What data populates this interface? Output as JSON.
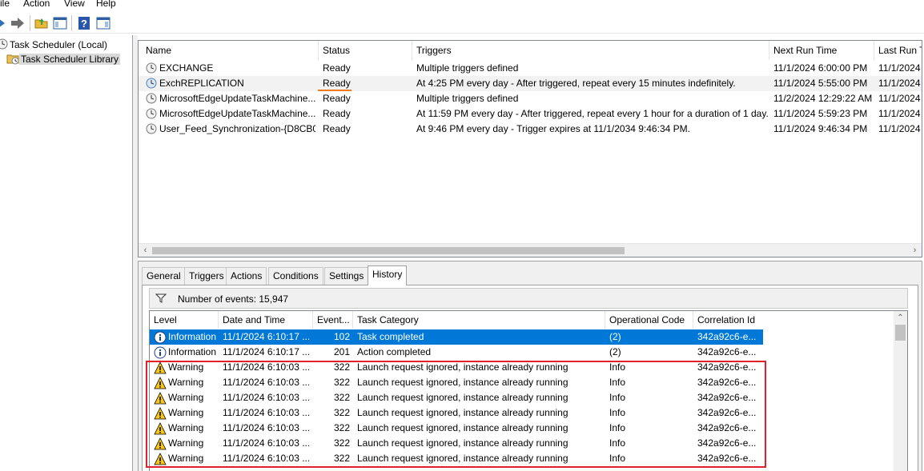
{
  "menu": [
    "ile",
    "Action",
    "View",
    "Help"
  ],
  "toolbar": {
    "buttons": [
      "back-arrow-icon",
      "forward-arrow-icon",
      "up-folder-icon",
      "show-hide-console-tree-icon",
      "help-icon",
      "show-hide-action-pane-icon"
    ]
  },
  "tree": {
    "root": "Task Scheduler (Local)",
    "library": "Task Scheduler Library"
  },
  "tasks": {
    "columns": [
      "Name",
      "Status",
      "Triggers",
      "Next Run Time",
      "Last Run T"
    ],
    "rows": [
      {
        "name": "EXCHANGE",
        "status": "Ready",
        "triggers": "Multiple triggers defined",
        "next": "11/1/2024 6:00:00 PM",
        "last": "11/1/2024"
      },
      {
        "name": "ExchREPLICATION",
        "status": "Ready",
        "triggers": "At 4:25 PM every day - After triggered, repeat every 15 minutes indefinitely.",
        "next": "11/1/2024 5:55:00 PM",
        "last": "11/1/2024"
      },
      {
        "name": "MicrosoftEdgeUpdateTaskMachine...",
        "status": "Ready",
        "triggers": "Multiple triggers defined",
        "next": "11/2/2024 12:29:22 AM",
        "last": "11/1/2024"
      },
      {
        "name": "MicrosoftEdgeUpdateTaskMachine...",
        "status": "Ready",
        "triggers": "At 11:59 PM every day - After triggered, repeat every 1 hour for a duration of 1 day.",
        "next": "11/1/2024 5:59:23 PM",
        "last": "11/1/2024"
      },
      {
        "name": "User_Feed_Synchronization-{D8CB0...",
        "status": "Ready",
        "triggers": "At 9:46 PM every day - Trigger expires at 11/1/2034 9:46:34 PM.",
        "next": "11/1/2024 9:46:34 PM",
        "last": "11/1/2024"
      }
    ]
  },
  "tabs": [
    "General",
    "Triggers",
    "Actions",
    "Conditions",
    "Settings",
    "History"
  ],
  "history": {
    "events_label": "Number of events: 15,947",
    "columns": [
      "Level",
      "Date and Time",
      "Event...",
      "Task Category",
      "Operational Code",
      "Correlation Id"
    ],
    "rows": [
      {
        "level": "Information",
        "date": "11/1/2024 6:10:17 ...",
        "event": "102",
        "category": "Task completed",
        "opcode": "(2)",
        "corr": "342a92c6-e..."
      },
      {
        "level": "Information",
        "date": "11/1/2024 6:10:17 ...",
        "event": "201",
        "category": "Action completed",
        "opcode": "(2)",
        "corr": "342a92c6-e..."
      },
      {
        "level": "Warning",
        "date": "11/1/2024 6:10:03 ...",
        "event": "322",
        "category": "Launch request ignored, instance already running",
        "opcode": "Info",
        "corr": "342a92c6-e..."
      },
      {
        "level": "Warning",
        "date": "11/1/2024 6:10:03 ...",
        "event": "322",
        "category": "Launch request ignored, instance already running",
        "opcode": "Info",
        "corr": "342a92c6-e..."
      },
      {
        "level": "Warning",
        "date": "11/1/2024 6:10:03 ...",
        "event": "322",
        "category": "Launch request ignored, instance already running",
        "opcode": "Info",
        "corr": "342a92c6-e..."
      },
      {
        "level": "Warning",
        "date": "11/1/2024 6:10:03 ...",
        "event": "322",
        "category": "Launch request ignored, instance already running",
        "opcode": "Info",
        "corr": "342a92c6-e..."
      },
      {
        "level": "Warning",
        "date": "11/1/2024 6:10:03 ...",
        "event": "322",
        "category": "Launch request ignored, instance already running",
        "opcode": "Info",
        "corr": "342a92c6-e..."
      },
      {
        "level": "Warning",
        "date": "11/1/2024 6:10:03 ...",
        "event": "322",
        "category": "Launch request ignored, instance already running",
        "opcode": "Info",
        "corr": "342a92c6-e..."
      },
      {
        "level": "Warning",
        "date": "11/1/2024 6:10:03 ...",
        "event": "322",
        "category": "Launch request ignored, instance already running",
        "opcode": "Info",
        "corr": "342a92c6-e..."
      }
    ]
  },
  "colors": {
    "selection": "#0078d7",
    "highlight_box": "#e0202a",
    "status_underline": "#f07a1c"
  }
}
